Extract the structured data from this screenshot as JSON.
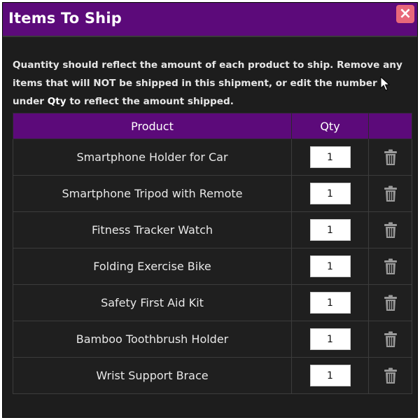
{
  "dialog": {
    "title": "Items To Ship",
    "close_label": "×",
    "instructions_part1": "Quantity should reflect the amount of each product to ship. Remove any items that will NOT be shipped in this shipment, or edit the number under ",
    "instructions_strong": "Qty",
    "instructions_part2": " to reflect the amount shipped."
  },
  "table": {
    "headers": {
      "product": "Product",
      "qty": "Qty",
      "actions": ""
    },
    "rows": [
      {
        "product": "Smartphone Holder for Car",
        "qty": "1"
      },
      {
        "product": "Smartphone Tripod with Remote",
        "qty": "1"
      },
      {
        "product": "Fitness Tracker Watch",
        "qty": "1"
      },
      {
        "product": "Folding Exercise Bike",
        "qty": "1"
      },
      {
        "product": "Safety First Aid Kit",
        "qty": "1"
      },
      {
        "product": "Bamboo Toothbrush Holder",
        "qty": "1"
      },
      {
        "product": "Wrist Support Brace",
        "qty": "1"
      }
    ]
  },
  "colors": {
    "header_purple": "#5c0a7a",
    "panel_bg": "#1d1d1d",
    "close_button": "#e8687a"
  },
  "icons": {
    "close": "close-icon",
    "delete": "trash-icon",
    "pointer": "mouse-pointer-icon"
  }
}
